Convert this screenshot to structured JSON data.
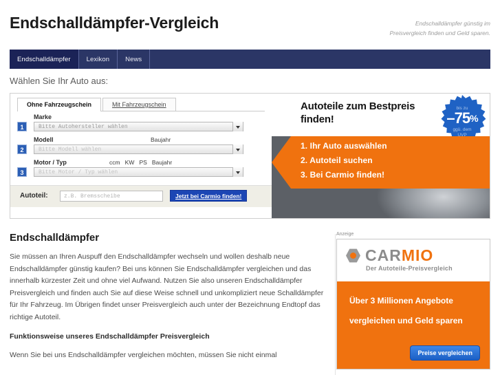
{
  "header": {
    "title": "Endschalldämpfer-Vergleich",
    "tagline_line1": "Endschalldämpfer günstig im",
    "tagline_line2": "Preisvergleich finden und Geld sparen."
  },
  "nav": {
    "items": [
      {
        "label": "Endschalldämpfer",
        "active": true
      },
      {
        "label": "Lexikon",
        "active": false
      },
      {
        "label": "News",
        "active": false
      }
    ]
  },
  "car_selector": {
    "heading": "Wählen Sie Ihr Auto aus:",
    "tabs": [
      {
        "label": "Ohne Fahrzeugschein",
        "active": true
      },
      {
        "label": "Mit Fahrzeugschein",
        "active": false
      }
    ],
    "fields": [
      {
        "step": "1",
        "label": "Marke",
        "extra": "",
        "placeholder": "Bitte Autohersteller wählen",
        "disabled": false
      },
      {
        "step": "2",
        "label": "Modell",
        "extra": "Baujahr",
        "placeholder": "Bitte Modell wählen",
        "disabled": true
      },
      {
        "step": "3",
        "label": "Motor / Typ",
        "extra": "ccm   KW   PS   Baujahr",
        "placeholder": "Bitte Motor / Typ wählen",
        "disabled": true
      }
    ],
    "part_label": "Autoteil:",
    "part_placeholder": "z.B. Bremsscheibe",
    "part_value": "",
    "submit_label": "Jetzt bei Carmio finden!"
  },
  "promo": {
    "headline": "Autoteile zum Bestpreis finden!",
    "discount_top": "bis zu",
    "discount_value": "–75",
    "discount_pct": "%",
    "discount_bottom_line1": "ggü. dem",
    "discount_bottom_line2": "UVP",
    "steps": [
      "1. Ihr Auto auswählen",
      "2. Autoteil suchen",
      "3. Bei Carmio finden!"
    ],
    "accent_color": "#f0720f",
    "badge_color": "#1f62c4"
  },
  "article": {
    "title": "Endschalldämpfer",
    "paragraph1": "Sie müssen an Ihren Auspuff den Endschalldämpfer wechseln und wollen deshalb neue Endschalldämpfer günstig kaufen? Bei uns können Sie Endschalldämpfer vergleichen und das innerhalb kürzester Zeit und ohne viel Aufwand. Nutzen Sie also unseren Endschalldämpfer Preisvergleich und finden auch Sie auf diese Weise schnell und unkompliziert neue Schalldämpfer für Ihr Fahrzeug. Im Übrigen findet unser Preisvergleich auch unter der Bezeichnung Endtopf das richtige Autoteil.",
    "subheading": "Funktionsweise unseres Endschalldämpfer Preisvergleich",
    "paragraph2": "Wenn Sie bei uns Endschalldämpfer vergleichen möchten, müssen Sie nicht einmal"
  },
  "ad": {
    "label": "Anzeige",
    "logo_part1": "CAR",
    "logo_part2": "MIO",
    "logo_subtitle": "Der Autoteile-Preisvergleich",
    "copy_line1": "Über 3 Millionen Angebote",
    "copy_line2": "vergleichen und Geld sparen",
    "cta_label": "Preise vergleichen"
  }
}
